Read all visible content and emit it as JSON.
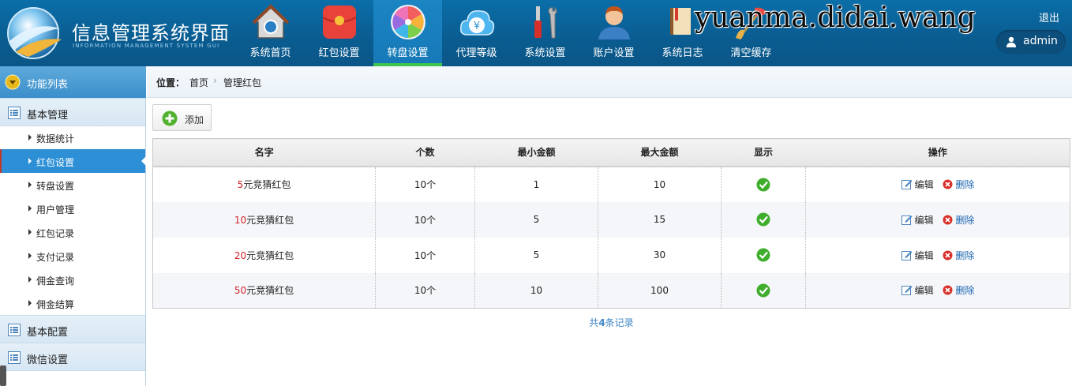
{
  "header": {
    "title": "信息管理系统界面",
    "subtitle": "INFORMATION MANAGEMENT SYSTEM GUI",
    "watermark": "yuanma.didai.wang",
    "logout": "退出",
    "user": "admin",
    "nav": [
      {
        "label": "系统首页",
        "icon": "house-icon"
      },
      {
        "label": "红包设置",
        "icon": "red-envelope-icon"
      },
      {
        "label": "转盘设置",
        "icon": "color-wheel-icon",
        "active": true
      },
      {
        "label": "代理等级",
        "icon": "yen-cloud-icon"
      },
      {
        "label": "系统设置",
        "icon": "tools-icon"
      },
      {
        "label": "账户设置",
        "icon": "user-account-icon"
      },
      {
        "label": "系统日志",
        "icon": "log-book-icon"
      },
      {
        "label": "清空缓存",
        "icon": "broom-icon"
      }
    ]
  },
  "sidebar": {
    "title": "功能列表",
    "groups": [
      {
        "label": "基本管理"
      },
      {
        "label": "基本配置"
      },
      {
        "label": "微信设置"
      }
    ],
    "items": [
      {
        "label": "数据统计"
      },
      {
        "label": "红包设置",
        "active": true
      },
      {
        "label": "转盘设置"
      },
      {
        "label": "用户管理"
      },
      {
        "label": "红包记录"
      },
      {
        "label": "支付记录"
      },
      {
        "label": "佣金查询"
      },
      {
        "label": "佣金结算"
      }
    ]
  },
  "breadcrumb": {
    "position_label": "位置：",
    "home": "首页",
    "separator": "›",
    "current": "管理红包"
  },
  "toolbar": {
    "add_label": "添加"
  },
  "table": {
    "columns": [
      "名字",
      "个数",
      "最小金额",
      "最大金额",
      "显示",
      "操作"
    ],
    "rows": [
      {
        "name_amount": "5",
        "name_suffix": "元竞猜红包",
        "count": "10个",
        "min": "1",
        "max": "10",
        "shown": true
      },
      {
        "name_amount": "10",
        "name_suffix": "元竞猜红包",
        "count": "10个",
        "min": "5",
        "max": "15",
        "shown": true
      },
      {
        "name_amount": "20",
        "name_suffix": "元竞猜红包",
        "count": "10个",
        "min": "5",
        "max": "30",
        "shown": true
      },
      {
        "name_amount": "50",
        "name_suffix": "元竞猜红包",
        "count": "10个",
        "min": "10",
        "max": "100",
        "shown": true
      }
    ],
    "edit_label": "编辑",
    "delete_label": "删除"
  },
  "pager": {
    "prefix": "共",
    "count": "4",
    "suffix": "条记录"
  },
  "colors": {
    "header_bg": "#0b5f94",
    "active_nav": "#1779b7",
    "sidebar_active": "#2d8fd6",
    "accent_green": "#3fc34f",
    "amount_red": "#d4242a"
  }
}
